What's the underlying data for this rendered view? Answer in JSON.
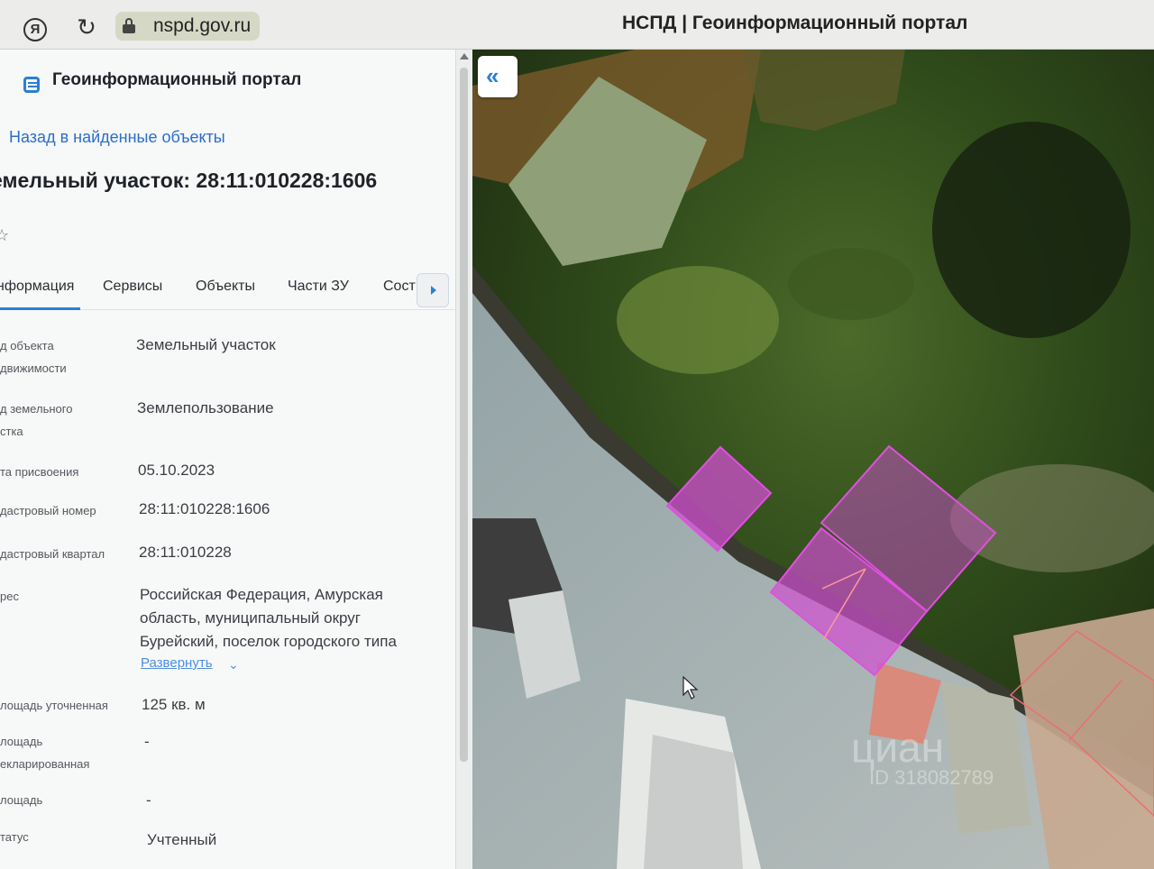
{
  "browser": {
    "url": "nspd.gov.ru",
    "window_title": "НСПД | Геоинформационный портал",
    "yandex_label": "Я",
    "reload_glyph": "↻"
  },
  "panel": {
    "portal_title": "Геоинформационный портал",
    "back_link": "Назад в найденные объекты",
    "object_title": "емельный участок: 28:11:010228:1606",
    "star": "☆",
    "tabs": [
      "нформация",
      "Сервисы",
      "Объекты",
      "Части ЗУ",
      "Сост"
    ],
    "fields": {
      "object_type": {
        "label_line1": "д объекта",
        "label_line2": "движимости",
        "value": "Земельный участок"
      },
      "plot_type": {
        "label_line1": "д земельного",
        "label_line2": "стка",
        "value": "Землепользование"
      },
      "date": {
        "label": "та присвоения",
        "value": "05.10.2023"
      },
      "cadastral_number": {
        "label": "дастровый номер",
        "value": "28:11:010228:1606"
      },
      "cadastral_quarter": {
        "label": "дастровый квартал",
        "value": "28:11:010228"
      },
      "address": {
        "label": "рес",
        "line1": "Российская Федерация, Амурская",
        "line2": "область, муниципальный округ",
        "line3": "Бурейский, поселок городского типа",
        "expand": "Развернуть"
      },
      "area_refined": {
        "label": "лощадь уточненная",
        "value": "125 кв. м"
      },
      "area_declared": {
        "label_line1": "лощадь",
        "label_line2": "екларированная",
        "value": "-"
      },
      "area": {
        "label": "лощадь",
        "value": "-"
      },
      "status": {
        "label": "татус",
        "value": "Учтенный"
      }
    }
  },
  "map": {
    "collapse_glyph": "«",
    "watermark_brand": "циан",
    "watermark_id": "ID 318082789",
    "highlight_color": "#d04fd0"
  }
}
